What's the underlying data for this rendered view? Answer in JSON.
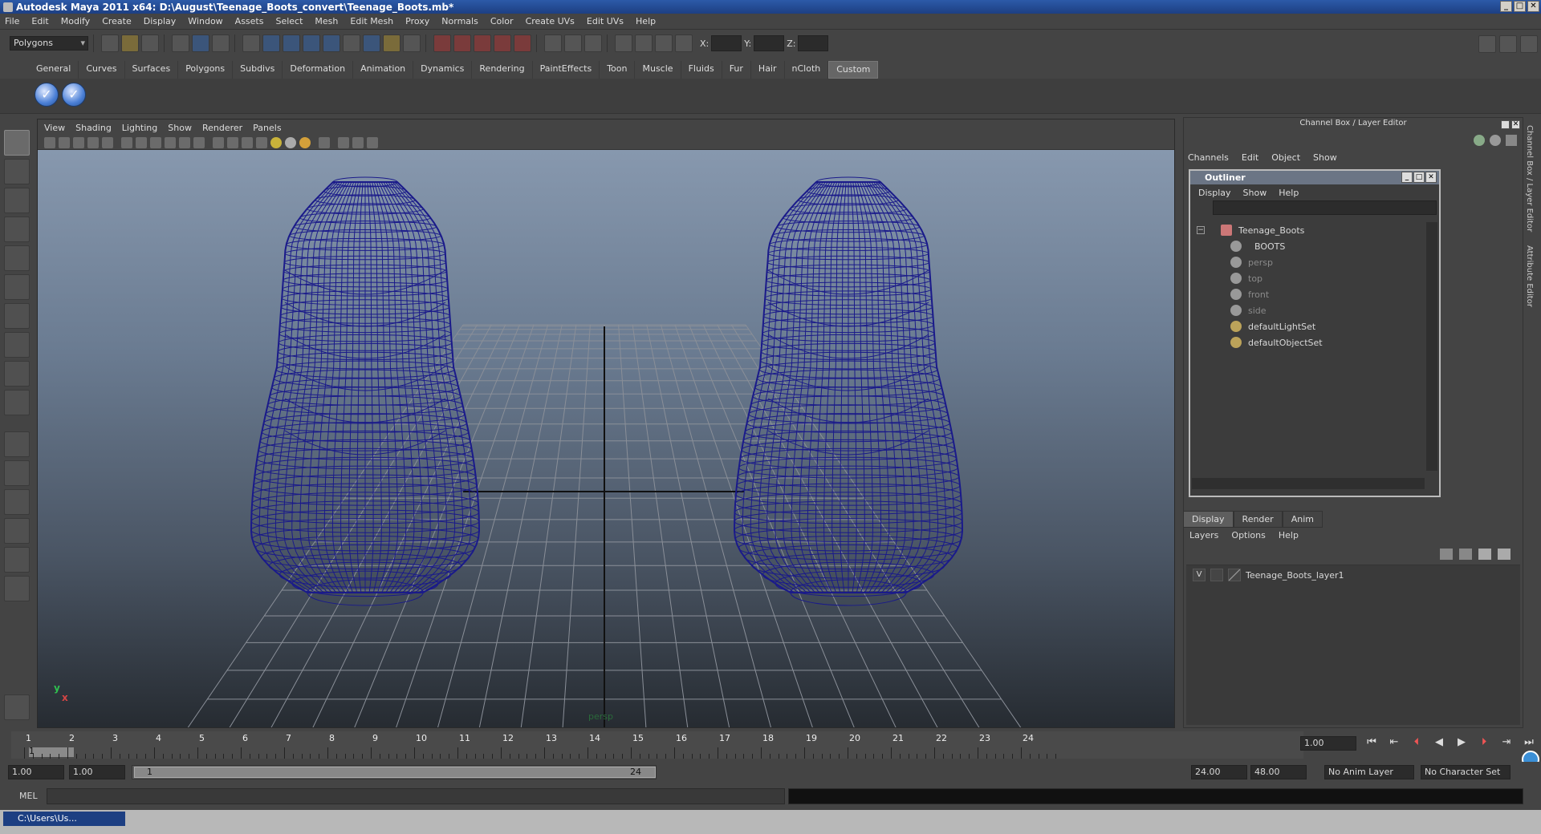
{
  "window": {
    "title": "Autodesk Maya 2011 x64: D:\\August\\Teenage_Boots_convert\\Teenage_Boots.mb*"
  },
  "menu": [
    "File",
    "Edit",
    "Modify",
    "Create",
    "Display",
    "Window",
    "Assets",
    "Select",
    "Mesh",
    "Edit Mesh",
    "Proxy",
    "Normals",
    "Color",
    "Create UVs",
    "Edit UVs",
    "Help"
  ],
  "status": {
    "mode": "Polygons",
    "x_label": "X:",
    "y_label": "Y:",
    "z_label": "Z:"
  },
  "shelf": {
    "tabs": [
      "General",
      "Curves",
      "Surfaces",
      "Polygons",
      "Subdivs",
      "Deformation",
      "Animation",
      "Dynamics",
      "Rendering",
      "PaintEffects",
      "Toon",
      "Muscle",
      "Fluids",
      "Fur",
      "Hair",
      "nCloth",
      "Custom"
    ],
    "active": "Custom"
  },
  "viewport": {
    "menu": [
      "View",
      "Shading",
      "Lighting",
      "Show",
      "Renderer",
      "Panels"
    ],
    "camera_label": "persp",
    "axis_y": "y",
    "axis_x": "x"
  },
  "channelbox": {
    "title": "Channel Box / Layer Editor",
    "menu": [
      "Channels",
      "Edit",
      "Object",
      "Show"
    ]
  },
  "outliner": {
    "title": "Outliner",
    "menu": [
      "Display",
      "Show",
      "Help"
    ],
    "items": [
      {
        "label": "Teenage_Boots",
        "dim": false,
        "indent": 0
      },
      {
        "label": "BOOTS",
        "dim": false,
        "indent": 1
      },
      {
        "label": "persp",
        "dim": true,
        "indent": 0
      },
      {
        "label": "top",
        "dim": true,
        "indent": 0
      },
      {
        "label": "front",
        "dim": true,
        "indent": 0
      },
      {
        "label": "side",
        "dim": true,
        "indent": 0
      },
      {
        "label": "defaultLightSet",
        "dim": false,
        "indent": 0
      },
      {
        "label": "defaultObjectSet",
        "dim": false,
        "indent": 0
      }
    ]
  },
  "layers": {
    "tabs": [
      "Display",
      "Render",
      "Anim"
    ],
    "active": "Display",
    "menu": [
      "Layers",
      "Options",
      "Help"
    ],
    "row": {
      "visible": "V",
      "name": "Teenage_Boots_layer1"
    }
  },
  "sidetabs": [
    "Channel Box / Layer Editor",
    "Attribute Editor"
  ],
  "timeline": {
    "ticks": [
      "1",
      "2",
      "3",
      "4",
      "5",
      "6",
      "7",
      "8",
      "9",
      "10",
      "11",
      "12",
      "13",
      "14",
      "15",
      "16",
      "17",
      "18",
      "19",
      "20",
      "21",
      "22",
      "23",
      "24"
    ],
    "current_marker": "1",
    "current_frame": "1.00"
  },
  "range": {
    "start": "1.00",
    "playback_start": "1.00",
    "slider_start": "1",
    "slider_end": "24",
    "playback_end": "24.00",
    "end": "48.00",
    "anim_layer": "No Anim Layer",
    "character_set": "No Character Set"
  },
  "cmd": {
    "label": "MEL"
  },
  "taskbar": {
    "item": "C:\\Users\\Us..."
  },
  "colors": {
    "wireframe": "#1a1a8a",
    "grid": "#8a8f98",
    "accent": "#2c5aa8"
  }
}
